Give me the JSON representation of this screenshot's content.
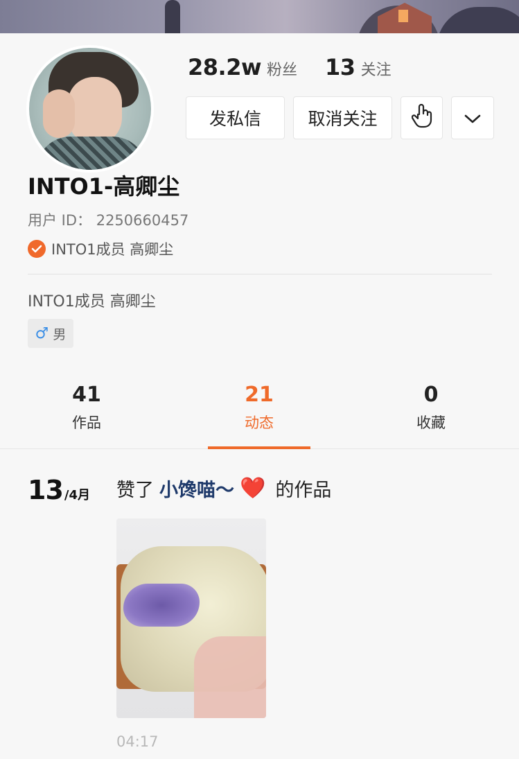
{
  "profile": {
    "followers_count": "28.2w",
    "followers_label": "粉丝",
    "following_count": "13",
    "following_label": "关注",
    "name": "INTO1-高卿尘",
    "user_id": "用户 ID： 2250660457",
    "verification": "INTO1成员 高卿尘",
    "bio": "INTO1成员 高卿尘",
    "gender": "男",
    "gender_symbol": "♂"
  },
  "actions": {
    "message_label": "发私信",
    "unfollow_label": "取消关注",
    "gesture_icon": "hand-pointer-icon",
    "more_icon": "chevron-down-icon"
  },
  "tabs": [
    {
      "count": "41",
      "label": "作品",
      "active": false
    },
    {
      "count": "21",
      "label": "动态",
      "active": true
    },
    {
      "count": "0",
      "label": "收藏",
      "active": false
    }
  ],
  "feed": {
    "day": "13",
    "month": "/4月",
    "prefix": "赞了",
    "username": "小馋喵～",
    "heart": "❤️",
    "suffix": "的作品",
    "time": "04:17"
  },
  "colors": {
    "accent": "#ef6a2a",
    "verify": "#f0692b",
    "link": "#1f3a6b"
  }
}
